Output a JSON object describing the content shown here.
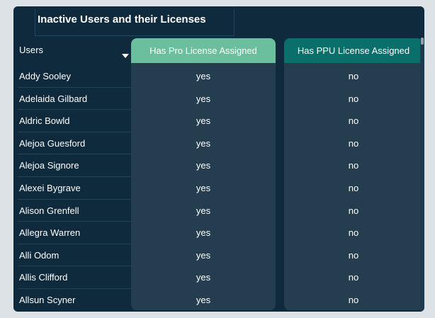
{
  "title": "Inactive Users and their Licenses",
  "columns": {
    "users": "Users",
    "pro": "Has Pro License Assigned",
    "ppu": "Has PPU License Assigned"
  },
  "sort_icon": "sort-descending-icon",
  "rows": [
    {
      "name": "Addy Sooley",
      "pro": "yes",
      "ppu": "no"
    },
    {
      "name": "Adelaida Gilbard",
      "pro": "yes",
      "ppu": "no"
    },
    {
      "name": "Aldric Bowld",
      "pro": "yes",
      "ppu": "no"
    },
    {
      "name": "Alejoa Guesford",
      "pro": "yes",
      "ppu": "no"
    },
    {
      "name": "Alejoa Signore",
      "pro": "yes",
      "ppu": "no"
    },
    {
      "name": "Alexei Bygrave",
      "pro": "yes",
      "ppu": "no"
    },
    {
      "name": "Alison Grenfell",
      "pro": "yes",
      "ppu": "no"
    },
    {
      "name": "Allegra Warren",
      "pro": "yes",
      "ppu": "no"
    },
    {
      "name": "Alli Odom",
      "pro": "yes",
      "ppu": "no"
    },
    {
      "name": "Allis Clifford",
      "pro": "yes",
      "ppu": "no"
    },
    {
      "name": "Allsun Scyner",
      "pro": "yes",
      "ppu": "no"
    }
  ],
  "colors": {
    "card": "#0e2a3c",
    "pro_header": "#6bbf9f",
    "ppu_header": "#0a6e6a",
    "column_body": "#243d4f"
  }
}
